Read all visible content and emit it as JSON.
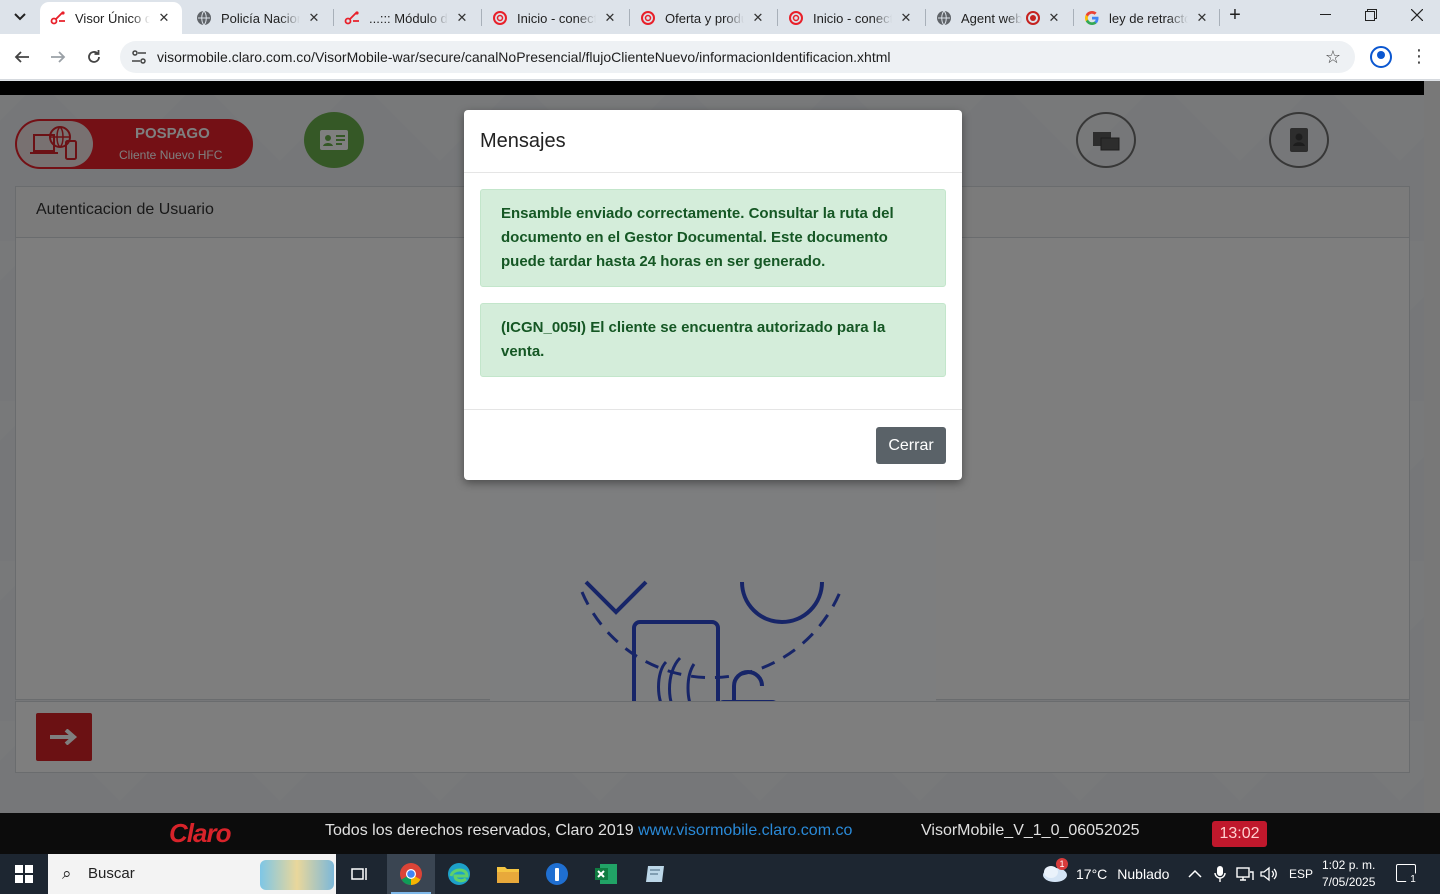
{
  "browser": {
    "tabs": [
      {
        "title": "Visor Único de",
        "active": true,
        "favicon": "claro-network-icon"
      },
      {
        "title": "Policía Naciona",
        "active": false,
        "favicon": "globe-icon"
      },
      {
        "title": "...::: Módulo de",
        "active": false,
        "favicon": "claro-network-icon"
      },
      {
        "title": "Inicio - conect",
        "active": false,
        "favicon": "claro-c-icon"
      },
      {
        "title": "Oferta y produ",
        "active": false,
        "favicon": "claro-c-icon"
      },
      {
        "title": "Inicio - conect",
        "active": false,
        "favicon": "claro-c-icon"
      },
      {
        "title": "Agent web",
        "active": false,
        "favicon": "globe-icon"
      },
      {
        "title": "ley de retracto",
        "active": false,
        "favicon": "google-icon"
      }
    ],
    "url": "visormobile.claro.com.co/VisorMobile-war/secure/canalNoPresencial/flujoClienteNuevo/informacionIdentificacion.xhtml"
  },
  "page": {
    "plan_type": "POSPAGO",
    "client_type": "Cliente Nuevo HFC",
    "section_title": "Autenticacion de Usuario",
    "accent_color": "#e8202a"
  },
  "modal": {
    "title": "Mensajes",
    "messages": [
      "Ensamble enviado correctamente. Consultar la ruta del documento en el Gestor Documental. Este documento puede tardar hasta 24 horas en ser generado.",
      "(ICGN_005I) El cliente se encuentra autorizado para la venta."
    ],
    "close_label": "Cerrar"
  },
  "footer": {
    "logo": "Claro",
    "copyright": "Todos los derechos reservados, Claro 2019",
    "link": "www.visormobile.claro.com.co",
    "version": "VisorMobile_V_1_0_06052025",
    "clock": "13:02"
  },
  "taskbar": {
    "search_placeholder": "Buscar",
    "weather_temp": "17°C",
    "weather_text": "Nublado",
    "weather_badge": "1",
    "language": "ESP",
    "time": "1:02 p. m.",
    "date": "7/05/2025",
    "notification_count": "1"
  }
}
